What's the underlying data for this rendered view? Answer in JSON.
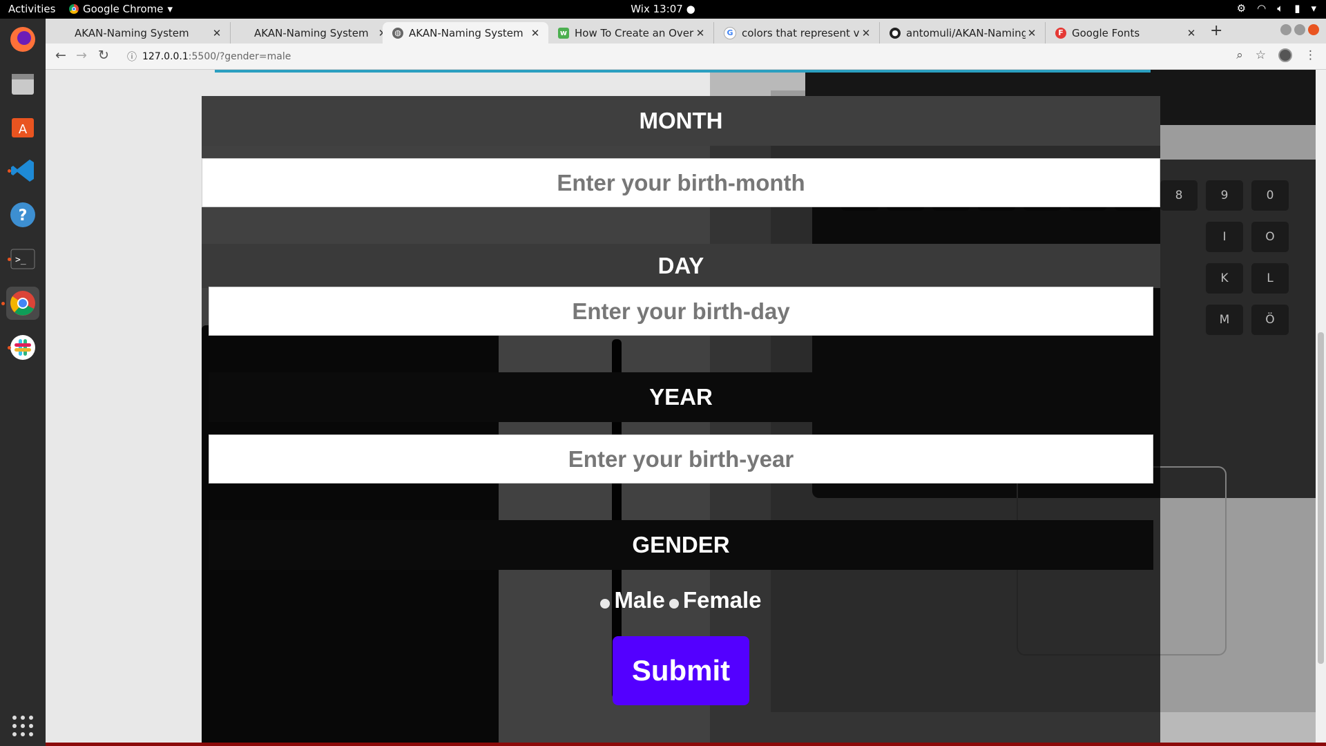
{
  "topbar": {
    "activities": "Activities",
    "app_name": "Google Chrome",
    "clock": "Wix 13:07 ●"
  },
  "dock": {
    "items": [
      "firefox",
      "files",
      "software-center",
      "vscode",
      "help",
      "terminal",
      "chrome",
      "slack",
      "show-apps"
    ]
  },
  "browser": {
    "tabs": [
      {
        "title": "AKAN-Naming System",
        "active": false,
        "favicon": "none"
      },
      {
        "title": "AKAN-Naming System",
        "active": false,
        "favicon": "none"
      },
      {
        "title": "AKAN-Naming System",
        "active": true,
        "favicon": "globe-icon"
      },
      {
        "title": "How To Create an Overlay",
        "active": false,
        "favicon": "w3schools-icon"
      },
      {
        "title": "colors that represent vict",
        "active": false,
        "favicon": "google-icon"
      },
      {
        "title": "antomuli/AKAN-Naming-",
        "active": false,
        "favicon": "github-icon"
      },
      {
        "title": "Google Fonts",
        "active": false,
        "favicon": "google-fonts-icon"
      }
    ],
    "url_host": "127.0.0.1",
    "url_rest": ":5500/?gender=male"
  },
  "form": {
    "month_label": "MONTH",
    "month_placeholder": "Enter your birth-month",
    "day_label": "DAY",
    "day_placeholder": "Enter your birth-day",
    "year_label": "YEAR",
    "year_placeholder": "Enter your birth-year",
    "gender_label": "GENDER",
    "gender_options": [
      "Male",
      "Female"
    ],
    "submit_label": "Submit"
  },
  "colors": {
    "submit_bg": "#5300ff",
    "accent_line": "#2b9fc0",
    "label_bar_bg": "#3a3a3a"
  }
}
